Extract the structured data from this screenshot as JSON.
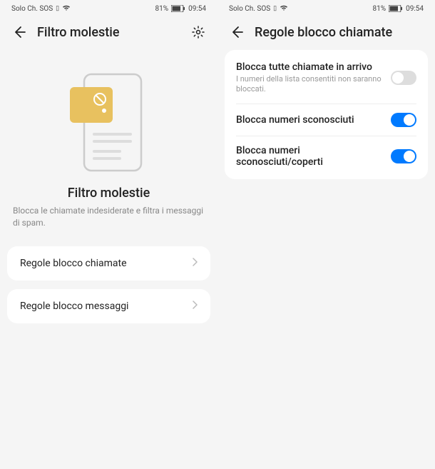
{
  "status": {
    "carrier": "Solo Ch. SOS",
    "battery_pct": "81%",
    "time": "09:54"
  },
  "screen1": {
    "title": "Filtro molestie",
    "hero_title": "Filtro molestie",
    "hero_desc": "Blocca le chiamate indesiderate e filtra i messaggi di spam.",
    "cards": [
      {
        "label": "Regole blocco chiamate"
      },
      {
        "label": "Regole blocco messaggi"
      }
    ]
  },
  "screen2": {
    "title": "Regole blocco chiamate",
    "settings": [
      {
        "title": "Blocca tutte chiamate in arrivo",
        "subtitle": "I numeri della lista consentiti non saranno bloccati.",
        "on": false
      },
      {
        "title": "Blocca numeri sconosciuti",
        "subtitle": "",
        "on": true
      },
      {
        "title": "Blocca numeri sconosciuti/coperti",
        "subtitle": "",
        "on": true
      }
    ]
  }
}
